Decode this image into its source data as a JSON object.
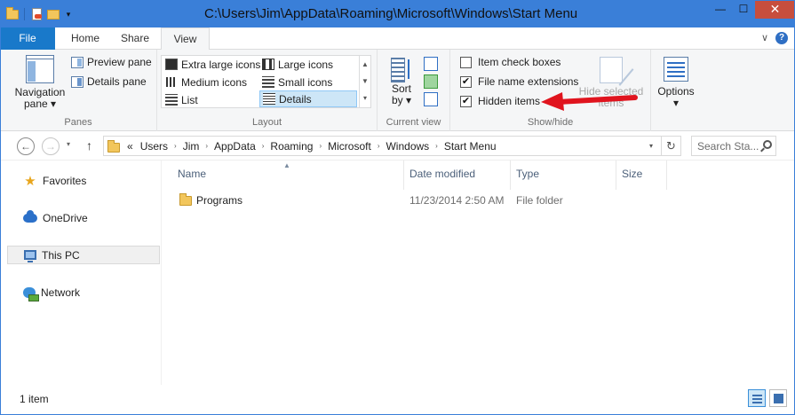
{
  "window": {
    "title": "C:\\Users\\Jim\\AppData\\Roaming\\Microsoft\\Windows\\Start Menu",
    "qat_dropdown": "▾",
    "minimize": "—",
    "maximize": "☐",
    "close": "✕"
  },
  "tabs": {
    "file": "File",
    "home": "Home",
    "share": "Share",
    "view": "View",
    "collapse": "∨",
    "help": "?"
  },
  "ribbon": {
    "panes": {
      "label": "Panes",
      "navigation_pane_line1": "Navigation",
      "navigation_pane_line2": "pane ▾",
      "preview_pane": "Preview pane",
      "details_pane": "Details pane"
    },
    "layout": {
      "label": "Layout",
      "items": [
        "Extra large icons",
        "Large icons",
        "Medium icons",
        "Small icons",
        "List",
        "Details"
      ],
      "selected": "Details",
      "scroll_up": "▲",
      "scroll_down": "▼",
      "more": "▾"
    },
    "current_view": {
      "label": "Current view",
      "sort_line1": "Sort",
      "sort_line2": "by ▾"
    },
    "show_hide": {
      "label": "Show/hide",
      "item_check_boxes": "Item check boxes",
      "item_check_boxes_checked": false,
      "file_name_extensions": "File name extensions",
      "file_name_extensions_checked": true,
      "hidden_items": "Hidden items",
      "hidden_items_checked": true,
      "hide_selected_line1": "Hide selected",
      "hide_selected_line2": "items",
      "check_mark": "✔"
    },
    "options": {
      "label": "Options",
      "dropdown": "▾"
    }
  },
  "navigation": {
    "back": "←",
    "forward": "→",
    "recent": "▾",
    "up": "↑",
    "breadcrumb_overflow": "«",
    "breadcrumb": [
      "Users",
      "Jim",
      "AppData",
      "Roaming",
      "Microsoft",
      "Windows",
      "Start Menu"
    ],
    "crumb_separator": "›",
    "address_dropdown": "▾",
    "refresh": "↻",
    "search_placeholder": "Search Sta..."
  },
  "nav_pane": {
    "items": [
      {
        "label": "Favorites",
        "icon": "star-icon"
      },
      {
        "label": "OneDrive",
        "icon": "cloud-icon"
      },
      {
        "label": "This PC",
        "icon": "computer-icon",
        "selected": true
      },
      {
        "label": "Network",
        "icon": "network-icon"
      }
    ]
  },
  "file_list": {
    "columns": [
      "Name",
      "Date modified",
      "Type",
      "Size"
    ],
    "sort_indicator": "▲",
    "rows": [
      {
        "name": "Programs",
        "date_modified": "11/23/2014 2:50 AM",
        "type": "File folder",
        "size": ""
      }
    ]
  },
  "status": {
    "item_count": "1 item"
  },
  "colors": {
    "title_bar": "#3a7fd8",
    "file_tab": "#1979ca",
    "close_button": "#c74e3d",
    "annotation_arrow": "#e0141e"
  }
}
